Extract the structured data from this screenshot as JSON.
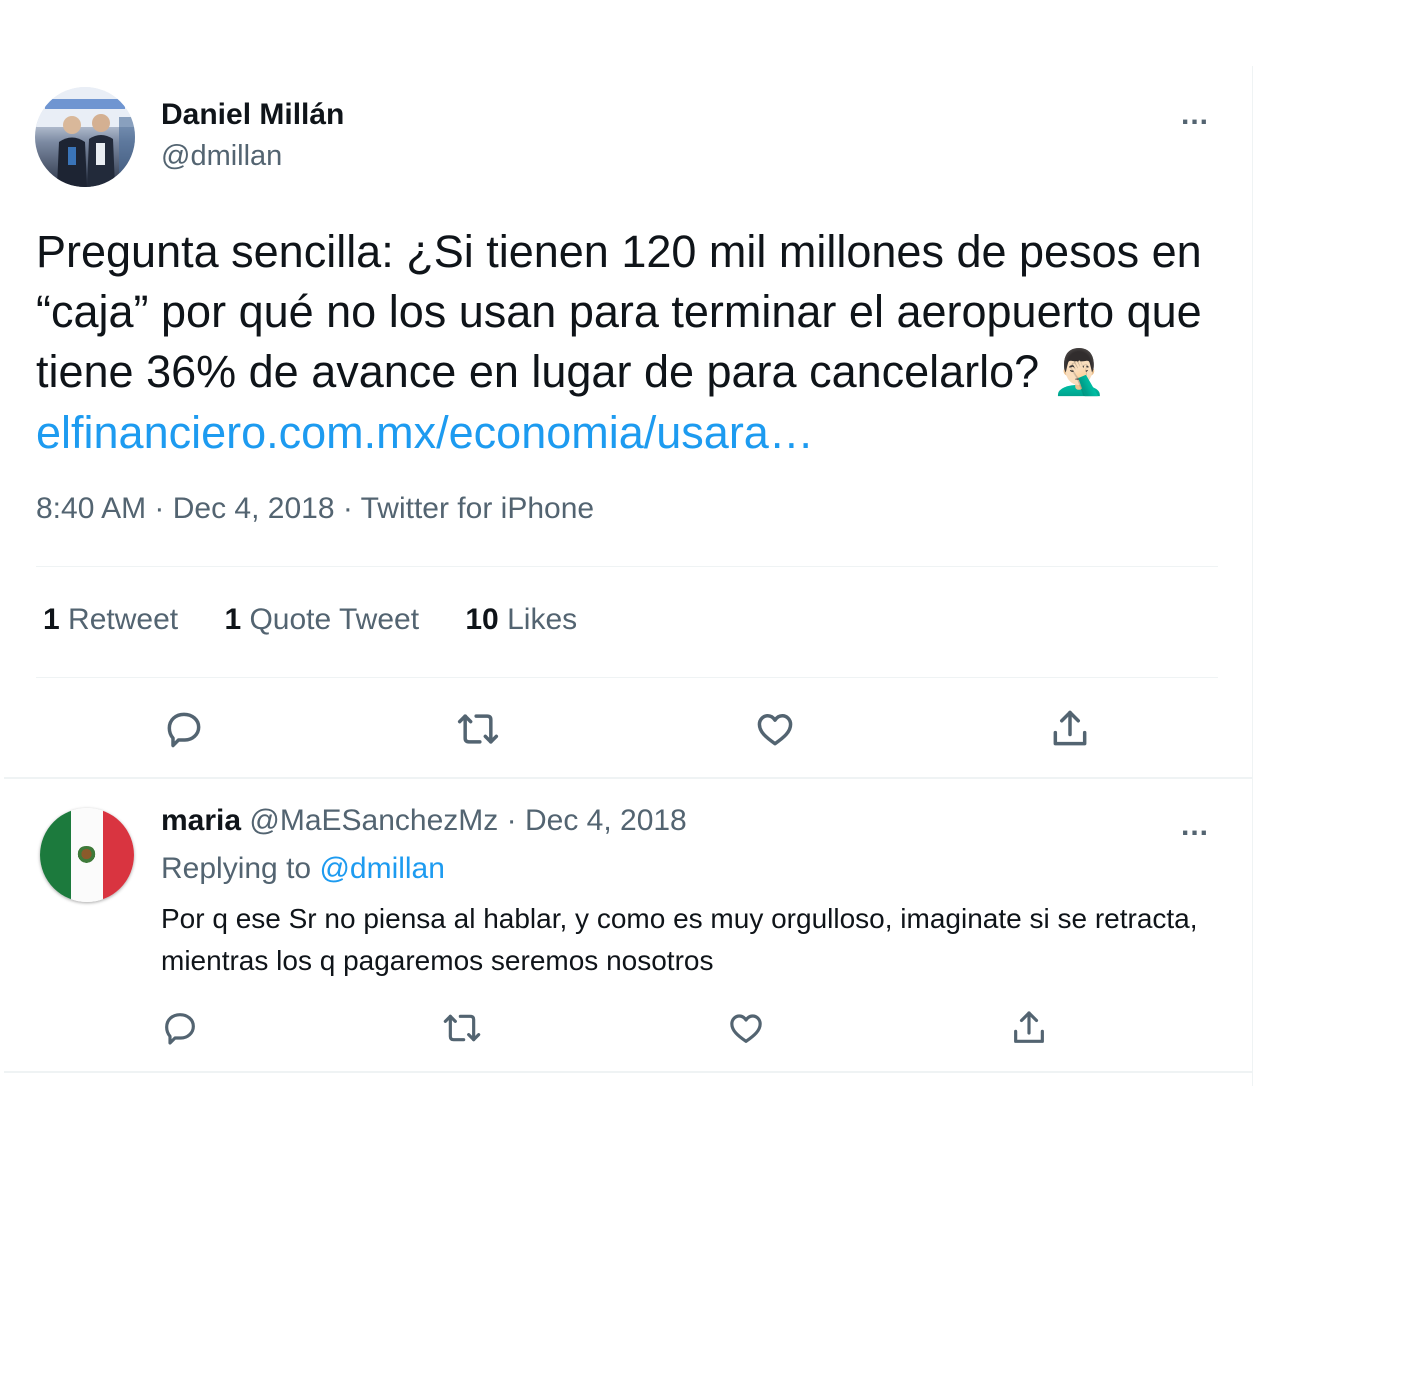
{
  "main_tweet": {
    "author_name": "Daniel Millán",
    "author_handle": "@dmillan",
    "more_icon": "...",
    "text_before_link": "Pregunta sencilla: ¿Si tienen 120 mil millones de pesos en “caja”  por qué no los usan para terminar el aeropuerto que tiene 36% de avance en lugar de para cancelarlo? ",
    "emoji": "🤦🏻‍♂️",
    "link_text": "elfinanciero.com.mx/economia/usara…",
    "meta": "8:40 AM · Dec 4, 2018 · Twitter for iPhone",
    "stats": {
      "retweets_count": "1",
      "retweets_label": "Retweet",
      "quotes_count": "1",
      "quotes_label": "Quote Tweet",
      "likes_count": "10",
      "likes_label": "Likes"
    },
    "actions": [
      "reply-icon",
      "retweet-icon",
      "like-icon",
      "share-icon"
    ]
  },
  "reply": {
    "author_name": "maria",
    "author_handle": "@MaESanchezMz",
    "separator": " · ",
    "date": "Dec 4, 2018",
    "more_icon": "...",
    "replying_label": "Replying to",
    "replying_handle": "@dmillan",
    "text": "Por q ese Sr no piensa al hablar, y como es muy orgulloso, imaginate si se retracta, mientras los q pagaremos seremos nosotros",
    "actions": [
      "reply-icon",
      "retweet-icon",
      "like-icon",
      "share-icon"
    ]
  },
  "colors": {
    "link": "#1d9bf0",
    "secondary_text": "#536471",
    "primary_text": "#0f1419",
    "divider": "#eff3f4"
  }
}
